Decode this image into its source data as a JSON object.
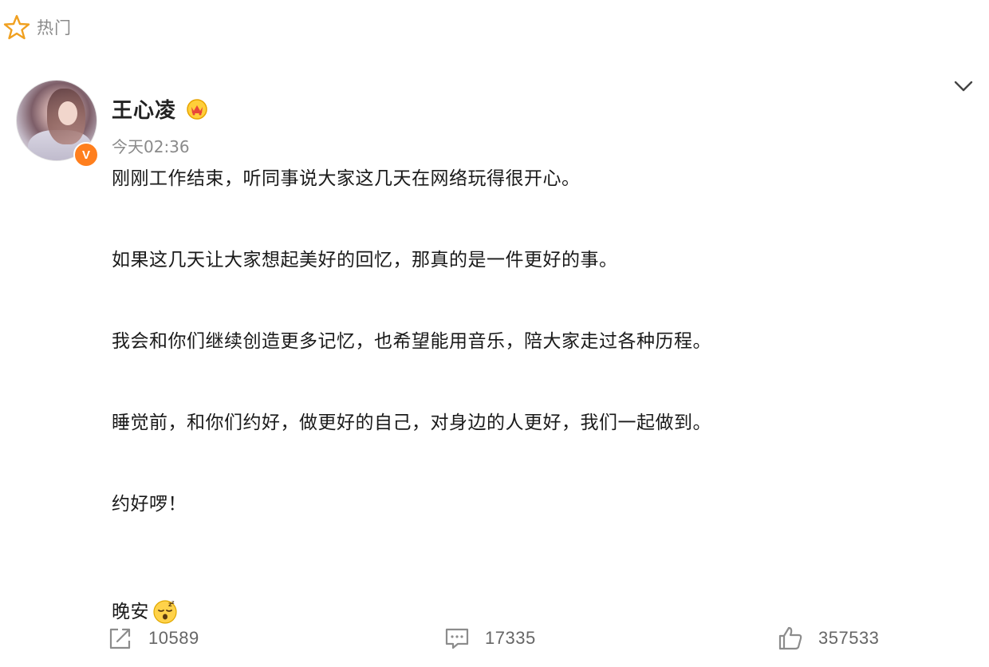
{
  "hot_tag": {
    "label": "热门"
  },
  "post": {
    "author": "王心凌",
    "verified_badge": "V",
    "timestamp": "今天02:36",
    "paragraphs": [
      "刚刚工作结束，听同事说大家这几天在网络玩得很开心。",
      "如果这几天让大家想起美好的回忆，那真的是一件更好的事。",
      "我会和你们继续创造更多记忆，也希望能用音乐，陪大家走过各种历程。",
      "睡觉前，和你们约好，做更好的自己，对身边的人更好，我们一起做到。",
      "约好啰！",
      "晚安"
    ]
  },
  "actions": {
    "share_count": "10589",
    "comment_count": "17335",
    "like_count": "357533"
  },
  "colors": {
    "verified_badge": "#ff7f1e",
    "muted_text": "#8a8a8a",
    "icon_gray": "#8c8c8c",
    "hot_star": "#f0a020"
  },
  "icons": {
    "hot": "star-icon",
    "menu": "chevron-down-icon",
    "crown": "crown-badge-icon",
    "emoji": "sleep-emoji-icon",
    "share": "share-icon",
    "comment": "comment-icon",
    "like": "thumbs-up-icon"
  }
}
